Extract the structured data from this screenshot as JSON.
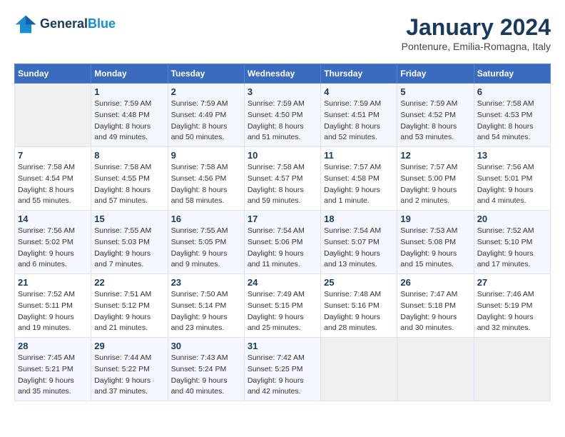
{
  "header": {
    "logo_general": "General",
    "logo_blue": "Blue",
    "month_year": "January 2024",
    "location": "Pontenure, Emilia-Romagna, Italy"
  },
  "days_of_week": [
    "Sunday",
    "Monday",
    "Tuesday",
    "Wednesday",
    "Thursday",
    "Friday",
    "Saturday"
  ],
  "weeks": [
    [
      {
        "day": "",
        "sunrise": "",
        "sunset": "",
        "daylight": ""
      },
      {
        "day": "1",
        "sunrise": "Sunrise: 7:59 AM",
        "sunset": "Sunset: 4:48 PM",
        "daylight": "Daylight: 8 hours and 49 minutes."
      },
      {
        "day": "2",
        "sunrise": "Sunrise: 7:59 AM",
        "sunset": "Sunset: 4:49 PM",
        "daylight": "Daylight: 8 hours and 50 minutes."
      },
      {
        "day": "3",
        "sunrise": "Sunrise: 7:59 AM",
        "sunset": "Sunset: 4:50 PM",
        "daylight": "Daylight: 8 hours and 51 minutes."
      },
      {
        "day": "4",
        "sunrise": "Sunrise: 7:59 AM",
        "sunset": "Sunset: 4:51 PM",
        "daylight": "Daylight: 8 hours and 52 minutes."
      },
      {
        "day": "5",
        "sunrise": "Sunrise: 7:59 AM",
        "sunset": "Sunset: 4:52 PM",
        "daylight": "Daylight: 8 hours and 53 minutes."
      },
      {
        "day": "6",
        "sunrise": "Sunrise: 7:58 AM",
        "sunset": "Sunset: 4:53 PM",
        "daylight": "Daylight: 8 hours and 54 minutes."
      }
    ],
    [
      {
        "day": "7",
        "sunrise": "Sunrise: 7:58 AM",
        "sunset": "Sunset: 4:54 PM",
        "daylight": "Daylight: 8 hours and 55 minutes."
      },
      {
        "day": "8",
        "sunrise": "Sunrise: 7:58 AM",
        "sunset": "Sunset: 4:55 PM",
        "daylight": "Daylight: 8 hours and 57 minutes."
      },
      {
        "day": "9",
        "sunrise": "Sunrise: 7:58 AM",
        "sunset": "Sunset: 4:56 PM",
        "daylight": "Daylight: 8 hours and 58 minutes."
      },
      {
        "day": "10",
        "sunrise": "Sunrise: 7:58 AM",
        "sunset": "Sunset: 4:57 PM",
        "daylight": "Daylight: 8 hours and 59 minutes."
      },
      {
        "day": "11",
        "sunrise": "Sunrise: 7:57 AM",
        "sunset": "Sunset: 4:58 PM",
        "daylight": "Daylight: 9 hours and 1 minute."
      },
      {
        "day": "12",
        "sunrise": "Sunrise: 7:57 AM",
        "sunset": "Sunset: 5:00 PM",
        "daylight": "Daylight: 9 hours and 2 minutes."
      },
      {
        "day": "13",
        "sunrise": "Sunrise: 7:56 AM",
        "sunset": "Sunset: 5:01 PM",
        "daylight": "Daylight: 9 hours and 4 minutes."
      }
    ],
    [
      {
        "day": "14",
        "sunrise": "Sunrise: 7:56 AM",
        "sunset": "Sunset: 5:02 PM",
        "daylight": "Daylight: 9 hours and 6 minutes."
      },
      {
        "day": "15",
        "sunrise": "Sunrise: 7:55 AM",
        "sunset": "Sunset: 5:03 PM",
        "daylight": "Daylight: 9 hours and 7 minutes."
      },
      {
        "day": "16",
        "sunrise": "Sunrise: 7:55 AM",
        "sunset": "Sunset: 5:05 PM",
        "daylight": "Daylight: 9 hours and 9 minutes."
      },
      {
        "day": "17",
        "sunrise": "Sunrise: 7:54 AM",
        "sunset": "Sunset: 5:06 PM",
        "daylight": "Daylight: 9 hours and 11 minutes."
      },
      {
        "day": "18",
        "sunrise": "Sunrise: 7:54 AM",
        "sunset": "Sunset: 5:07 PM",
        "daylight": "Daylight: 9 hours and 13 minutes."
      },
      {
        "day": "19",
        "sunrise": "Sunrise: 7:53 AM",
        "sunset": "Sunset: 5:08 PM",
        "daylight": "Daylight: 9 hours and 15 minutes."
      },
      {
        "day": "20",
        "sunrise": "Sunrise: 7:52 AM",
        "sunset": "Sunset: 5:10 PM",
        "daylight": "Daylight: 9 hours and 17 minutes."
      }
    ],
    [
      {
        "day": "21",
        "sunrise": "Sunrise: 7:52 AM",
        "sunset": "Sunset: 5:11 PM",
        "daylight": "Daylight: 9 hours and 19 minutes."
      },
      {
        "day": "22",
        "sunrise": "Sunrise: 7:51 AM",
        "sunset": "Sunset: 5:12 PM",
        "daylight": "Daylight: 9 hours and 21 minutes."
      },
      {
        "day": "23",
        "sunrise": "Sunrise: 7:50 AM",
        "sunset": "Sunset: 5:14 PM",
        "daylight": "Daylight: 9 hours and 23 minutes."
      },
      {
        "day": "24",
        "sunrise": "Sunrise: 7:49 AM",
        "sunset": "Sunset: 5:15 PM",
        "daylight": "Daylight: 9 hours and 25 minutes."
      },
      {
        "day": "25",
        "sunrise": "Sunrise: 7:48 AM",
        "sunset": "Sunset: 5:16 PM",
        "daylight": "Daylight: 9 hours and 28 minutes."
      },
      {
        "day": "26",
        "sunrise": "Sunrise: 7:47 AM",
        "sunset": "Sunset: 5:18 PM",
        "daylight": "Daylight: 9 hours and 30 minutes."
      },
      {
        "day": "27",
        "sunrise": "Sunrise: 7:46 AM",
        "sunset": "Sunset: 5:19 PM",
        "daylight": "Daylight: 9 hours and 32 minutes."
      }
    ],
    [
      {
        "day": "28",
        "sunrise": "Sunrise: 7:45 AM",
        "sunset": "Sunset: 5:21 PM",
        "daylight": "Daylight: 9 hours and 35 minutes."
      },
      {
        "day": "29",
        "sunrise": "Sunrise: 7:44 AM",
        "sunset": "Sunset: 5:22 PM",
        "daylight": "Daylight: 9 hours and 37 minutes."
      },
      {
        "day": "30",
        "sunrise": "Sunrise: 7:43 AM",
        "sunset": "Sunset: 5:24 PM",
        "daylight": "Daylight: 9 hours and 40 minutes."
      },
      {
        "day": "31",
        "sunrise": "Sunrise: 7:42 AM",
        "sunset": "Sunset: 5:25 PM",
        "daylight": "Daylight: 9 hours and 42 minutes."
      },
      {
        "day": "",
        "sunrise": "",
        "sunset": "",
        "daylight": ""
      },
      {
        "day": "",
        "sunrise": "",
        "sunset": "",
        "daylight": ""
      },
      {
        "day": "",
        "sunrise": "",
        "sunset": "",
        "daylight": ""
      }
    ]
  ]
}
